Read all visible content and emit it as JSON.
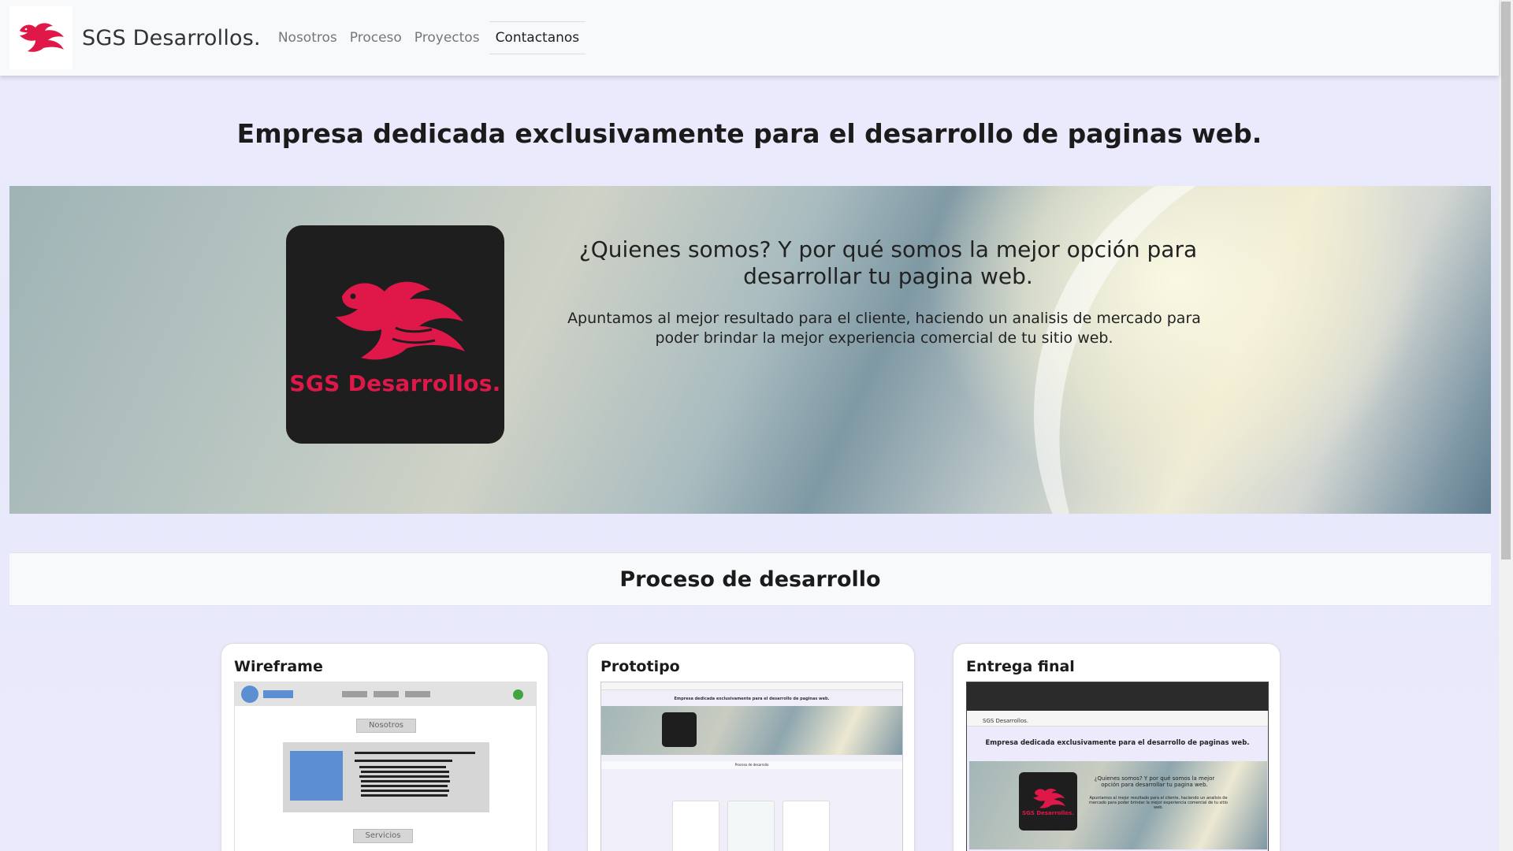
{
  "navbar": {
    "brand_name": "SGS Desarrollos.",
    "logo_icon": "phoenix-logo-icon",
    "links": [
      {
        "label": "Nosotros"
      },
      {
        "label": "Proceso"
      },
      {
        "label": "Proyectos"
      },
      {
        "label": "Contactanos",
        "active": true
      }
    ]
  },
  "headline": "Empresa dedicada exclusivamente para el desarrollo de paginas web.",
  "hero": {
    "logo_text": "SGS Desarrollos.",
    "title": "¿Quienes somos? Y por qué somos la mejor opción para desarrollar tu pagina web.",
    "text": "Apuntamos al mejor resultado para el cliente, haciendo un analisis de mercado para poder brindar la mejor experiencia comercial de tu sitio web."
  },
  "process": {
    "title": "Proceso de desarrollo",
    "cards": [
      {
        "title": "Wireframe",
        "wireframe": {
          "tab1": "Nosotros",
          "tab2": "Servicios"
        }
      },
      {
        "title": "Prototipo",
        "mini": {
          "headline": "Empresa dedicada exclusivamente para el desarrollo de paginas web.",
          "section": "Proceso de desarrollo"
        }
      },
      {
        "title": "Entrega final",
        "final": {
          "brand": "SGS Desarrollos.",
          "headline": "Empresa dedicada exclusivamente para el desarrollo de paginas web.",
          "hero_title": "¿Quienes somos? Y por qué somos la mejor opción para desarrollar tu pagina web.",
          "hero_text": "Apuntamos al mejor resultado para el cliente, haciendo un analisis de mercado para poder brindar la mejor experiencia comercial de tu sitio web.",
          "logo_text": "SGS Desarrollos."
        }
      }
    ]
  },
  "colors": {
    "brand_red": "#e01749",
    "logo_bg": "#1e1e1f",
    "wireframe_blue": "#5b8fd1"
  }
}
